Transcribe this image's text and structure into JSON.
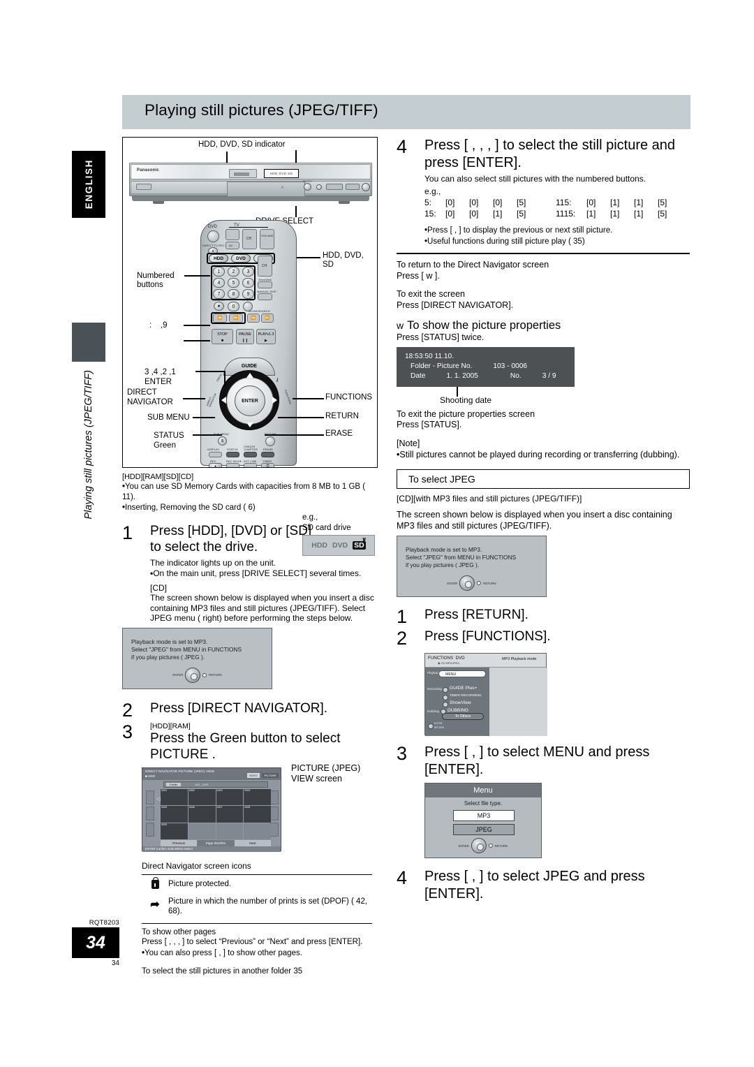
{
  "page": {
    "title": "Playing still pictures (JPEG/TIFF)",
    "language_tab": "ENGLISH",
    "side_title": "Playing still pictures (JPEG/TIFF)",
    "doc_code": "RQT8203",
    "page_number": "34",
    "page_number_small": "34"
  },
  "figure": {
    "unit_indicator_label": "HDD, DVD, SD indicator",
    "drive_select_label": "DRIVE SELECT",
    "unit_brand": "Panasonic",
    "unit_indicator_text": "HDD DVD SD",
    "callouts": {
      "hdd_dvd_sd": "HDD, DVD,\nSD",
      "numbered_buttons": "Numbered\nbuttons",
      "skip_buttons": ":    ,9",
      "cursor_enter": "3 ,4 ,2 ,1\nENTER",
      "direct_navigator": "DIRECT\nNAVIGATOR",
      "functions": "FUNCTIONS",
      "sub_menu": "SUB MENU",
      "return": "RETURN",
      "status_green": "STATUS\nGreen",
      "erase": "ERASE"
    },
    "remote": {
      "top_label": "DVD",
      "tv_label": "TV",
      "direct_tv_rec": "DIRECT TV REC",
      "av": "AV",
      "ch": "CH",
      "volume": "VOLUME",
      "drive_buttons": [
        "HDD",
        "DVD",
        "SD"
      ],
      "numbers": [
        "1",
        "2",
        "3",
        "4",
        "5",
        "6",
        "7",
        "8",
        "9",
        "0"
      ],
      "cancel": "CANCEL",
      "tv_slot": "TV SLOT",
      "page": "PAGE",
      "showview": "ShowView",
      "manual_skip": "MANUAL SKIP",
      "slow_search": "SLOW/SEARCH",
      "transport": [
        "STOP",
        "PAUSE",
        "PLAYx1.3"
      ],
      "guide": "GUIDE",
      "enter": "ENTER",
      "prog": "PROG",
      "dn_side": "DIRECT NAVIGATOR",
      "fn_side": "FUNCTIONS",
      "submenu_key": "SUB MENU",
      "return_key": "RETURN",
      "bottom_keys": [
        "DISPLAY",
        "STATUS",
        "CREATE CHAPTER",
        "ERASE"
      ],
      "bottom_keys2": [
        "REC",
        "REC MODE",
        "EXT LINK",
        "TIMER"
      ]
    }
  },
  "left_column": {
    "media_tags": "[HDD][RAM][SD][CD]",
    "bullets": [
      "You can use SD Memory Cards with capacities from 8 MB to 1 GB ( 11).",
      "Inserting, Removing the SD card (  6)"
    ],
    "step1": {
      "number": "1",
      "heading": "Press [HDD], [DVD] or [SD] to select the drive.",
      "line1": "The indicator lights up on the unit.",
      "bullet1": "On the main unit, press [DRIVE SELECT] several times.",
      "cd_tag": "[CD]",
      "cd_text": "The screen shown below is displayed when you insert a disc containing MP3 files and still pictures (JPEG/TIFF). Select JPEG menu (  right) before performing the steps below.",
      "eg_label": "e.g.,",
      "eg_label2": "SD card drive",
      "drive_chip": [
        "HDD",
        "DVD",
        "SD"
      ]
    },
    "osd_note": [
      "Playback mode is set to MP3.",
      "Select \"JPEG\" from MENU in FUNCTIONS",
      "if you play pictures ( JPEG )."
    ],
    "osd_cursor": {
      "enter": "ENTER",
      "return": "RETURN"
    },
    "step2": {
      "number": "2",
      "heading": "Press [DIRECT NAVIGATOR]."
    },
    "step3": {
      "number": "3",
      "media_tag": "[HDD][RAM]",
      "heading": "Press the  Green  button to select  PICTURE .",
      "screen_caption": "PICTURE (JPEG) VIEW screen"
    },
    "direct_navigator_screen": {
      "title": "DIRECT NAVIGATOR   PICTURE (JPEG) VIEW",
      "subtitle": "HDD",
      "tag_video": "VIDEO",
      "tag_picture": "PICTURE",
      "folder_label": "Folder",
      "folder_value": "103__DVD",
      "thumbs": [
        "0001",
        "0002",
        "0003",
        "0004",
        "0005",
        "0006",
        "0007",
        "0008",
        "0009"
      ],
      "previous": "Previous",
      "page_info": "Page 001/001",
      "next": "Next",
      "footer": "ENTER Confirm    SUB MENU    Select"
    },
    "icons_legend": {
      "heading": "Direct Navigator screen icons",
      "rows": [
        {
          "icon": "lock-icon",
          "text": "Picture protected."
        },
        {
          "icon": "dpof-icon",
          "text": "Picture in which the number of prints is set (DPOF) (  42, 68)."
        }
      ]
    },
    "other_pages": {
      "heading": "To show other pages",
      "line1": "Press [ ,  ,  ,  ] to select “Previous” or “Next” and press [ENTER].",
      "bullet1": "You can also press [      ,       ] to show other pages.",
      "line2": "To select the still pictures in another folder   35"
    }
  },
  "right_column": {
    "step4": {
      "number": "4",
      "heading": "Press [  ,  ,  ,  ] to select the still picture and press [ENTER].",
      "line1": "You can also select still pictures with the numbered buttons.",
      "eg": "e.g.,",
      "examples": [
        {
          "label": "5:",
          "keys": [
            "[0]",
            "[0]",
            "[0]",
            "[5]"
          ],
          "label2": "115:",
          "keys2": [
            "[0]",
            "[1]",
            "[1]",
            "[5]"
          ]
        },
        {
          "label": "15:",
          "keys": [
            "[0]",
            "[0]",
            "[1]",
            "[5]"
          ],
          "label2": "1115:",
          "keys2": [
            "[1]",
            "[1]",
            "[1]",
            "[5]"
          ]
        }
      ],
      "bullets": [
        "Press [  ,  ] to display the previous or next still picture.",
        "Useful functions during still picture play (  35)"
      ]
    },
    "return_dn": {
      "heading": "To return to the Direct Navigator screen",
      "text": "Press [ w ]."
    },
    "exit_screen": {
      "heading": "To exit the screen",
      "text": "Press [DIRECT NAVIGATOR]."
    },
    "properties": {
      "heading": "To show the picture properties",
      "heading_marker": "w",
      "text": "Press [STATUS] twice.",
      "osd": {
        "time": "18:53:50 11.10.",
        "folder_label": "Folder - Picture No.",
        "folder_value": "103 - 0006",
        "date_label": "Date",
        "date_value": "1. 1. 2005",
        "no_label": "No.",
        "no_value": "3 / 9"
      },
      "shooting_date_label": "Shooting date",
      "exit_heading": "To exit the picture properties screen",
      "exit_text": "Press [STATUS]."
    },
    "note": {
      "heading": "[Note]",
      "bullet": "Still pictures cannot be played during recording or transferring (dubbing)."
    },
    "select_jpeg": {
      "box_title": "To select JPEG",
      "media_tag": "[CD][with MP3 files and still pictures (JPEG/TIFF)]",
      "text": "The screen shown below is displayed when you insert a disc containing MP3 files and still pictures (JPEG/TIFF).",
      "osd_note": [
        "Playback mode is set to MP3.",
        "Select \"JPEG\" from MENU in FUNCTIONS",
        "if you play pictures ( JPEG )."
      ],
      "step1": {
        "number": "1",
        "heading": "Press [RETURN]."
      },
      "step2": {
        "number": "2",
        "heading": "Press [FUNCTIONS]."
      },
      "functions_screen": {
        "title": "FUNCTIONS",
        "drive": "DVD",
        "disc_type": "CD MP3/JPEG",
        "mode": "MP3 Playback mode",
        "cat_playback": "Playback",
        "item_menu": "MENU",
        "cat_recording": "Recording",
        "item_guide": "GUIDE Plus+",
        "item_timer": "TIMER RECORDING",
        "item_showview": "ShowView",
        "cat_dubbing": "Dubbing",
        "item_dubbing": "DUBBING",
        "to_others": "To Others",
        "enter": "ENTER",
        "return": "RETURN"
      },
      "step3": {
        "number": "3",
        "heading": "Press [  ,  ] to select  MENU  and press [ENTER]."
      },
      "menu_screen": {
        "title": "Menu",
        "prompt": "Select file type.",
        "options": [
          "MP3",
          "JPEG"
        ],
        "enter": "ENTER",
        "return": "RETURN"
      },
      "step4": {
        "number": "4",
        "heading": "Press [  ,  ] to select  JPEG  and press [ENTER]."
      }
    }
  }
}
